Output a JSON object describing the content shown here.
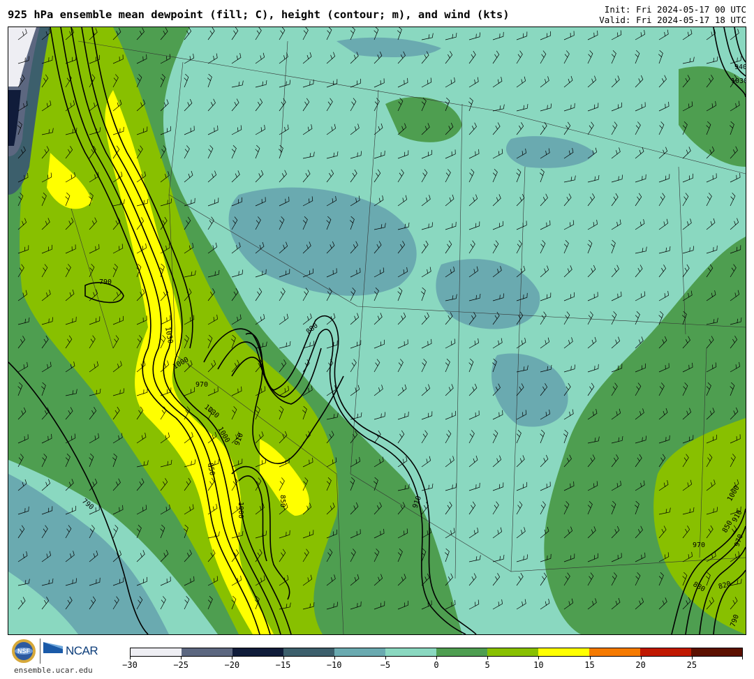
{
  "header": {
    "title": "925 hPa ensemble mean dewpoint (fill; C), height (contour; m), and wind (kts)",
    "init": "Init: Fri 2024-05-17 00 UTC",
    "valid": "Valid: Fri 2024-05-17 18 UTC"
  },
  "footer": {
    "site": "ensemble.ucar.edu",
    "logo_ncar": "NCAR",
    "logo_nsf": "NSF"
  },
  "colorbar": {
    "colors": [
      "#eeeef3",
      "#5c6780",
      "#101c3a",
      "#3c5f6c",
      "#6aaab0",
      "#8ad8c0",
      "#4e9e50",
      "#88c000",
      "#ffff00",
      "#f57a00",
      "#c01800",
      "#5c1000"
    ],
    "labels": [
      "−30",
      "−25",
      "−20",
      "−15",
      "−10",
      "−5",
      "0",
      "5",
      "10",
      "15",
      "20",
      "25"
    ]
  },
  "map": {
    "fill_colors": {
      "base": "#8ad8c0",
      "dry": "#6aaab0",
      "very_dry": "#3c5f6c",
      "moist": "#4e9e50",
      "moister": "#88c000",
      "moistest": "#ffff00",
      "dark": "#101c3a",
      "grey": "#5c6780",
      "white": "#eeeef3"
    },
    "contour_labels": [
      "790",
      "790",
      "790",
      "940",
      "1030",
      "1000",
      "970",
      "1030",
      "1000",
      "910",
      "850",
      "820",
      "790",
      "880",
      "1000",
      "850",
      "910",
      "1030",
      "970",
      "820",
      "880",
      "880",
      "790",
      "1000",
      "910",
      "940",
      "850",
      "970",
      "880",
      "820",
      "910",
      "880",
      "940",
      "850",
      "1030",
      "1000"
    ]
  }
}
